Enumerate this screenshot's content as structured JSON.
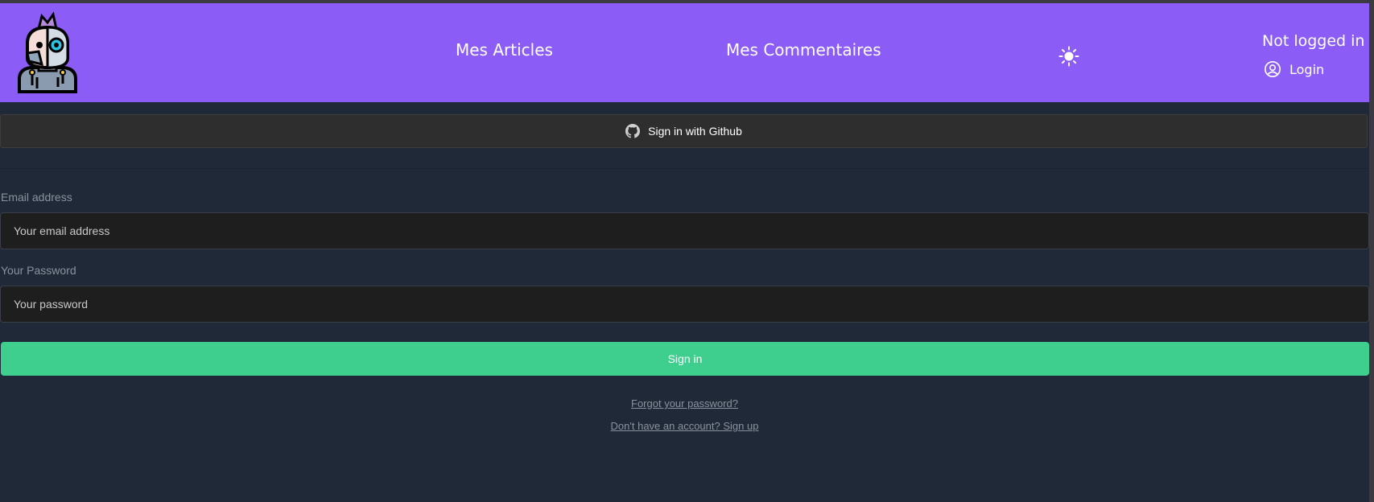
{
  "header": {
    "logo_icon": "robot-avatar-icon",
    "nav": [
      {
        "label": "Mes Articles"
      },
      {
        "label": "Mes Commentaires"
      }
    ],
    "theme_toggle_icon": "sun-icon",
    "status": "Not logged in",
    "login_label": "Login",
    "login_icon": "user-circle-icon",
    "background_color": "#8b5cf6"
  },
  "auth": {
    "github_button_label": "Sign in with Github",
    "github_icon": "github-icon",
    "email_label": "Email address",
    "email_placeholder": "Your email address",
    "password_label": "Your Password",
    "password_placeholder": "Your password",
    "signin_button_label": "Sign in",
    "signin_button_color": "#3ecf8e",
    "forgot_link": "Forgot your password?",
    "signup_link": "Don't have an account? Sign up"
  },
  "theme": {
    "page_background": "#1f2937",
    "input_background": "#1e1e1e"
  }
}
